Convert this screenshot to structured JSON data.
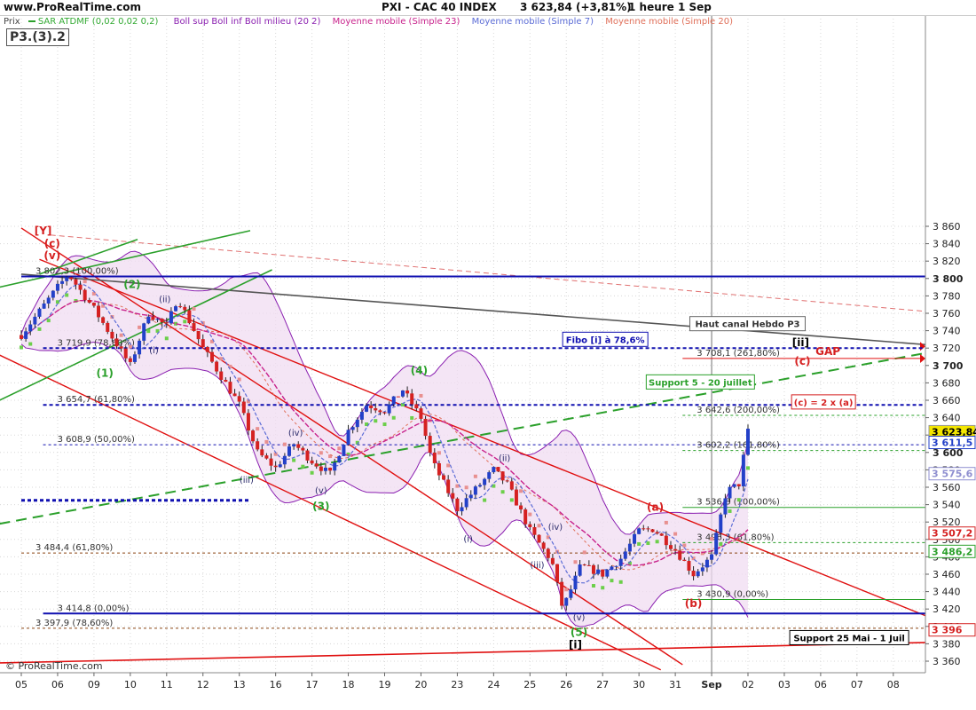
{
  "header": {
    "site": "www.ProRealTime.com",
    "title": "PXI - CAC 40 INDEX",
    "price": "3 623,84 (+3,81%)",
    "period": "1 heure  1 Sep",
    "watermark": "© ProRealTime.com"
  },
  "legend": {
    "prefix": "Prix",
    "items": [
      {
        "text": "SAR ATDMF (0,02 0,02 0,2)",
        "color": "#33aa33"
      },
      {
        "text": "Boll sup Boll inf Boll milieu (20 2)",
        "color": "#8a1fb0"
      },
      {
        "text": "Moyenne mobile (Simple 23)",
        "color": "#c8238c"
      },
      {
        "text": "Moyenne mobile (Simple 7)",
        "color": "#5b6cd6"
      },
      {
        "text": "Moyenne mobile (Simple 20)",
        "color": "#e0705a"
      }
    ]
  },
  "tag": "P3.(3).2",
  "colors": {
    "up": "#2340c8",
    "down": "#d52121",
    "channel": "#e01010",
    "green": "#2ba02b",
    "blue": "#1010b0",
    "boll": "#8a1fb0",
    "bollFill": "#f0dcf2"
  },
  "chart_data": {
    "type": "candlestick",
    "ylim": [
      3350,
      3870
    ],
    "x_ticks": [
      "05",
      "06",
      "09",
      "10",
      "11",
      "12",
      "13",
      "16",
      "17",
      "18",
      "19",
      "20",
      "23",
      "24",
      "25",
      "26",
      "27",
      "30",
      "31",
      "Sep",
      "02",
      "03",
      "06",
      "07",
      "08"
    ],
    "y_ticks": [
      3360,
      3380,
      3400,
      3420,
      3440,
      3460,
      3480,
      3500,
      3520,
      3540,
      3560,
      3580,
      3600,
      3620,
      3640,
      3660,
      3680,
      3700,
      3720,
      3740,
      3760,
      3780,
      3800,
      3820,
      3840,
      3860
    ],
    "y_tick_labels": [
      "3 360",
      "3 380",
      "3 400",
      "3 420",
      "3 440",
      "3 460",
      "3 480",
      "3 500",
      "3 520",
      "3 540",
      "3 560",
      "3 580",
      "3 600",
      "3 620",
      "3 640",
      "3 660",
      "3 680",
      "3 700",
      "3 720",
      "3 740",
      "3 760",
      "3 780",
      "3 800",
      "3 820",
      "3 840",
      "3 860"
    ],
    "price_path": [
      [
        0,
        3735
      ],
      [
        1,
        3790
      ],
      [
        1.3,
        3805
      ],
      [
        2,
        3765
      ],
      [
        3,
        3700
      ],
      [
        3.5,
        3760
      ],
      [
        4,
        3745
      ],
      [
        4.3,
        3778
      ],
      [
        5,
        3720
      ],
      [
        6,
        3655
      ],
      [
        6.5,
        3600
      ],
      [
        7,
        3582
      ],
      [
        7.5,
        3610
      ],
      [
        8,
        3590
      ],
      [
        8.5,
        3575
      ],
      [
        9,
        3625
      ],
      [
        9.5,
        3655
      ],
      [
        10,
        3648
      ],
      [
        10.5,
        3672
      ],
      [
        11,
        3640
      ],
      [
        11.3,
        3590
      ],
      [
        12,
        3535
      ],
      [
        12.6,
        3562
      ],
      [
        13,
        3580
      ],
      [
        13.4,
        3562
      ],
      [
        14,
        3510
      ],
      [
        14.6,
        3475
      ],
      [
        14.9,
        3420
      ],
      [
        15.4,
        3470
      ],
      [
        16,
        3460
      ],
      [
        16.5,
        3478
      ],
      [
        17,
        3510
      ],
      [
        17.4,
        3512
      ],
      [
        18,
        3488
      ],
      [
        18.5,
        3460
      ],
      [
        19,
        3480
      ],
      [
        19.4,
        3555
      ],
      [
        19.8,
        3565
      ],
      [
        19.95,
        3624
      ]
    ],
    "levels": [
      {
        "label": "3 802,3 (100,00%)",
        "value": 3802.3,
        "x_from": 0,
        "color": "blue",
        "style": "solid",
        "w": 2
      },
      {
        "label": "3 719,9 (78,60%)",
        "value": 3719.9,
        "x_from": 0.6,
        "color": "blue",
        "style": "dash",
        "w": 2
      },
      {
        "label": "3 654,7 (61,80%)",
        "value": 3654.7,
        "x_from": 0.6,
        "color": "blue",
        "style": "dash",
        "w": 2
      },
      {
        "label": "3 608,9 (50,00%)",
        "value": 3608.9,
        "x_from": 0.6,
        "color": "blue",
        "style": "dash",
        "w": 1
      },
      {
        "label": "",
        "value": 3545,
        "x_from": 0,
        "x_to": 6.3,
        "color": "blue",
        "style": "dash",
        "w": 3
      },
      {
        "label": "3 484,4 (61,80%)",
        "value": 3484.4,
        "x_from": 0,
        "color": "brown",
        "style": "dash",
        "w": 1
      },
      {
        "label": "3 414,8 (0,00%)",
        "value": 3414.8,
        "x_from": 0.6,
        "color": "blue",
        "style": "solid",
        "w": 2
      },
      {
        "label": "3 397,9 (78,60%)",
        "value": 3397.9,
        "x_from": 0,
        "color": "brown",
        "style": "dash",
        "w": 1
      },
      {
        "label": "3 708,1 (261,80%)",
        "value": 3708.1,
        "x_from": 18.2,
        "color": "red",
        "style": "solid",
        "w": 1
      },
      {
        "label": "3 642,6 (200,00%)",
        "value": 3642.6,
        "x_from": 18.2,
        "color": "green",
        "style": "dash",
        "w": 1
      },
      {
        "label": "3 602,2 (161,80%)",
        "value": 3602.2,
        "x_from": 18.2,
        "color": "green",
        "style": "dash",
        "w": 1
      },
      {
        "label": "3 536,8 (100,00%)",
        "value": 3536.8,
        "x_from": 18.2,
        "color": "green",
        "style": "solid",
        "w": 1
      },
      {
        "label": "3 496,3 (61,80%)",
        "value": 3496.3,
        "x_from": 18.2,
        "color": "green",
        "style": "dash",
        "w": 1
      },
      {
        "label": "3 430,9 (0,00%)",
        "value": 3430.9,
        "x_from": 18.2,
        "color": "green",
        "style": "solid",
        "w": 1
      }
    ],
    "wave_labels": [
      {
        "t": "(v)",
        "x": 0.85,
        "y": 3822,
        "c": "red"
      },
      {
        "t": "(c)",
        "x": 0.85,
        "y": 3836,
        "c": "red"
      },
      {
        "t": "(2)",
        "x": 3.05,
        "y": 3789,
        "c": "green"
      },
      {
        "t": "(ii)",
        "x": 3.95,
        "y": 3773,
        "c": "navy"
      },
      {
        "t": "(i)",
        "x": 3.65,
        "y": 3714,
        "c": "navy"
      },
      {
        "t": "(1)",
        "x": 2.3,
        "y": 3687,
        "c": "green"
      },
      {
        "t": "(iv)",
        "x": 7.55,
        "y": 3619,
        "c": "navy"
      },
      {
        "t": "(iii)",
        "x": 6.2,
        "y": 3565,
        "c": "navy"
      },
      {
        "t": "(v)",
        "x": 8.25,
        "y": 3553,
        "c": "navy"
      },
      {
        "t": "(3)",
        "x": 8.25,
        "y": 3534,
        "c": "green"
      },
      {
        "t": "(4)",
        "x": 10.95,
        "y": 3690,
        "c": "green"
      },
      {
        "t": "(ii)",
        "x": 13.3,
        "y": 3590,
        "c": "navy"
      },
      {
        "t": "(iv)",
        "x": 14.7,
        "y": 3511,
        "c": "navy"
      },
      {
        "t": "(i)",
        "x": 12.3,
        "y": 3497,
        "c": "navy"
      },
      {
        "t": "(iii)",
        "x": 14.2,
        "y": 3467,
        "c": "navy"
      },
      {
        "t": "(v)",
        "x": 15.35,
        "y": 3407,
        "c": "navy"
      },
      {
        "t": "(5)",
        "x": 15.35,
        "y": 3389,
        "c": "green"
      },
      {
        "t": "(a)",
        "x": 17.45,
        "y": 3533,
        "c": "red"
      },
      {
        "t": "(b)",
        "x": 18.5,
        "y": 3422,
        "c": "red"
      },
      {
        "t": "(c)",
        "x": 21.5,
        "y": 3701,
        "c": "red"
      }
    ],
    "boxes": [
      {
        "t": "Haut canal Hebdo P3",
        "x": 18.4,
        "y": 3744,
        "w": 130,
        "border": "#666",
        "color": "#333"
      },
      {
        "t": "Fibo [i] à 78,6%",
        "x": 14.9,
        "y": 3726,
        "w": 96,
        "border": "#1010b0",
        "color": "#1010b0"
      },
      {
        "t": "Support 5 - 20 juillet",
        "x": 17.2,
        "y": 3677,
        "w": 122,
        "border": "#2ba02b",
        "color": "#2ba02b"
      },
      {
        "t": "(c) = 2 x (a)",
        "x": 21.2,
        "y": 3654,
        "w": 72,
        "border": "#d52121",
        "color": "#d52121"
      },
      {
        "t": "Support 25 Mai - 1 Juil",
        "x": 21.15,
        "y": 3383,
        "w": 134,
        "border": "#000",
        "color": "#000"
      }
    ],
    "plain_labels": [
      {
        "t": "[Y]",
        "x": 0.6,
        "y": 3851,
        "c": "#d52121",
        "b": true
      },
      {
        "t": "[ii]",
        "x": 21.45,
        "y": 3722,
        "c": "#000",
        "b": true
      },
      {
        "t": "GAP",
        "x": 22.2,
        "y": 3712,
        "c": "#d52121",
        "b": true
      },
      {
        "t": "[i]",
        "x": 15.25,
        "y": 3375,
        "c": "#000",
        "b": true
      }
    ],
    "right_tags": [
      {
        "label": "3 623,84",
        "value": 3623.84,
        "bg": "#f3e600",
        "color": "#000"
      },
      {
        "label": "3 611,5",
        "value": 3611.5,
        "bg": "#fff",
        "color": "#2340c8"
      },
      {
        "label": "3 575,6",
        "value": 3575.6,
        "bg": "#fff",
        "color": "#8f8fd0"
      },
      {
        "label": "3 507,2",
        "value": 3507.2,
        "bg": "#fff",
        "color": "#d52121"
      },
      {
        "label": "3 486,2",
        "value": 3486.2,
        "bg": "#fff",
        "color": "#2ba02b"
      },
      {
        "label": "3 396",
        "value": 3396,
        "bg": "#fff",
        "color": "#d52121"
      }
    ]
  }
}
